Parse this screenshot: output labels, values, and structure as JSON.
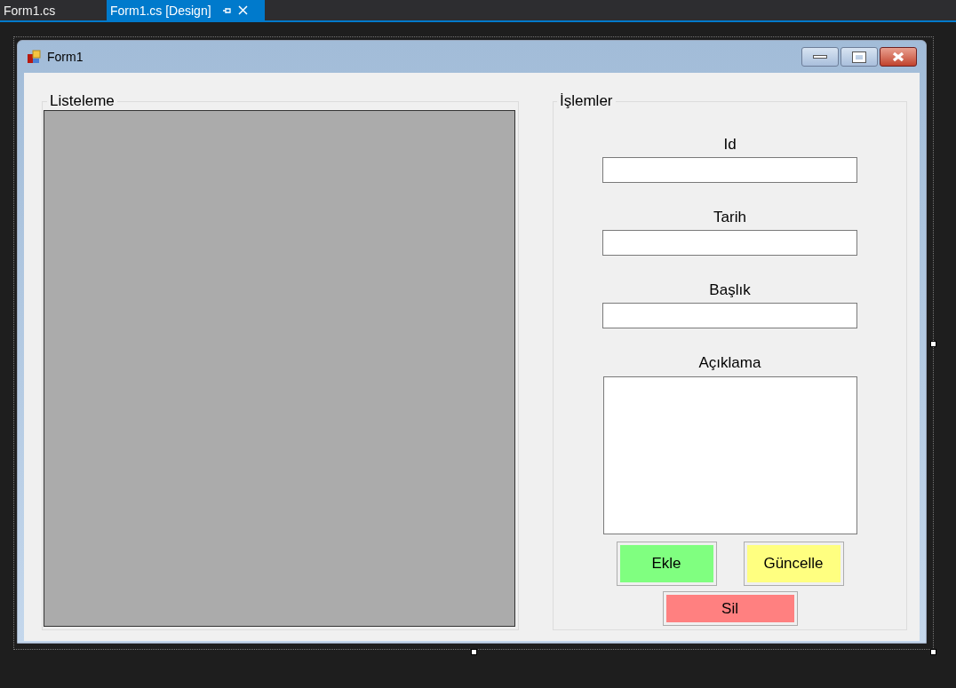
{
  "tabs": [
    {
      "label": "Form1.cs",
      "selected": false
    },
    {
      "label": "Form1.cs [Design]",
      "selected": true
    }
  ],
  "window": {
    "title": "Form1"
  },
  "list_group": {
    "title": "Listeleme"
  },
  "actions_group": {
    "title": "İşlemler",
    "fields": [
      {
        "kind": "input",
        "label": "Id"
      },
      {
        "kind": "input",
        "label": "Tarih"
      },
      {
        "kind": "input",
        "label": "Başlık"
      },
      {
        "kind": "textarea",
        "label": "Açıklama"
      }
    ],
    "buttons": [
      {
        "label": "Ekle",
        "color": "#80ff80"
      },
      {
        "label": "Güncelle",
        "color": "#ffff80"
      },
      {
        "label": "Sil",
        "color": "#ff8080"
      }
    ]
  }
}
